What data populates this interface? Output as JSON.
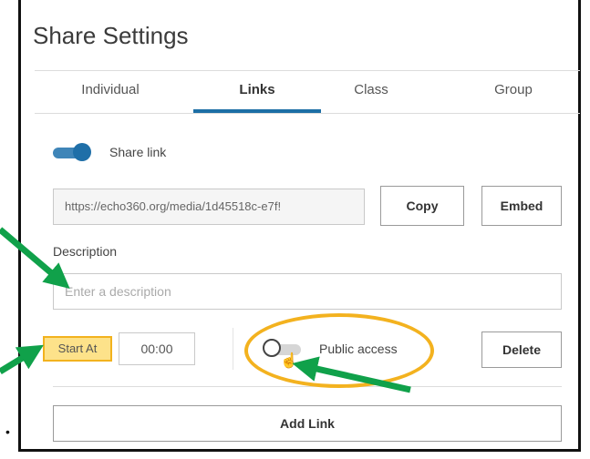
{
  "header": {
    "title": "Share Settings"
  },
  "tabs": [
    {
      "label": "Individual",
      "active": false
    },
    {
      "label": "Links",
      "active": true
    },
    {
      "label": "Class",
      "active": false
    },
    {
      "label": "Group",
      "active": false
    }
  ],
  "share_link": {
    "label": "Share link",
    "enabled": true,
    "url": "https://echo360.org/media/1d45518c-e7f!"
  },
  "buttons": {
    "copy": "Copy",
    "embed": "Embed",
    "delete": "Delete",
    "add_link": "Add Link"
  },
  "description": {
    "label": "Description",
    "placeholder": "Enter a description"
  },
  "start_at": {
    "label": "Start At",
    "value": "00:00"
  },
  "public_access": {
    "label": "Public access",
    "enabled": false
  },
  "colors": {
    "accent": "#1d6fa5",
    "highlight": "#f3b21f",
    "arrow": "#10a14a"
  }
}
